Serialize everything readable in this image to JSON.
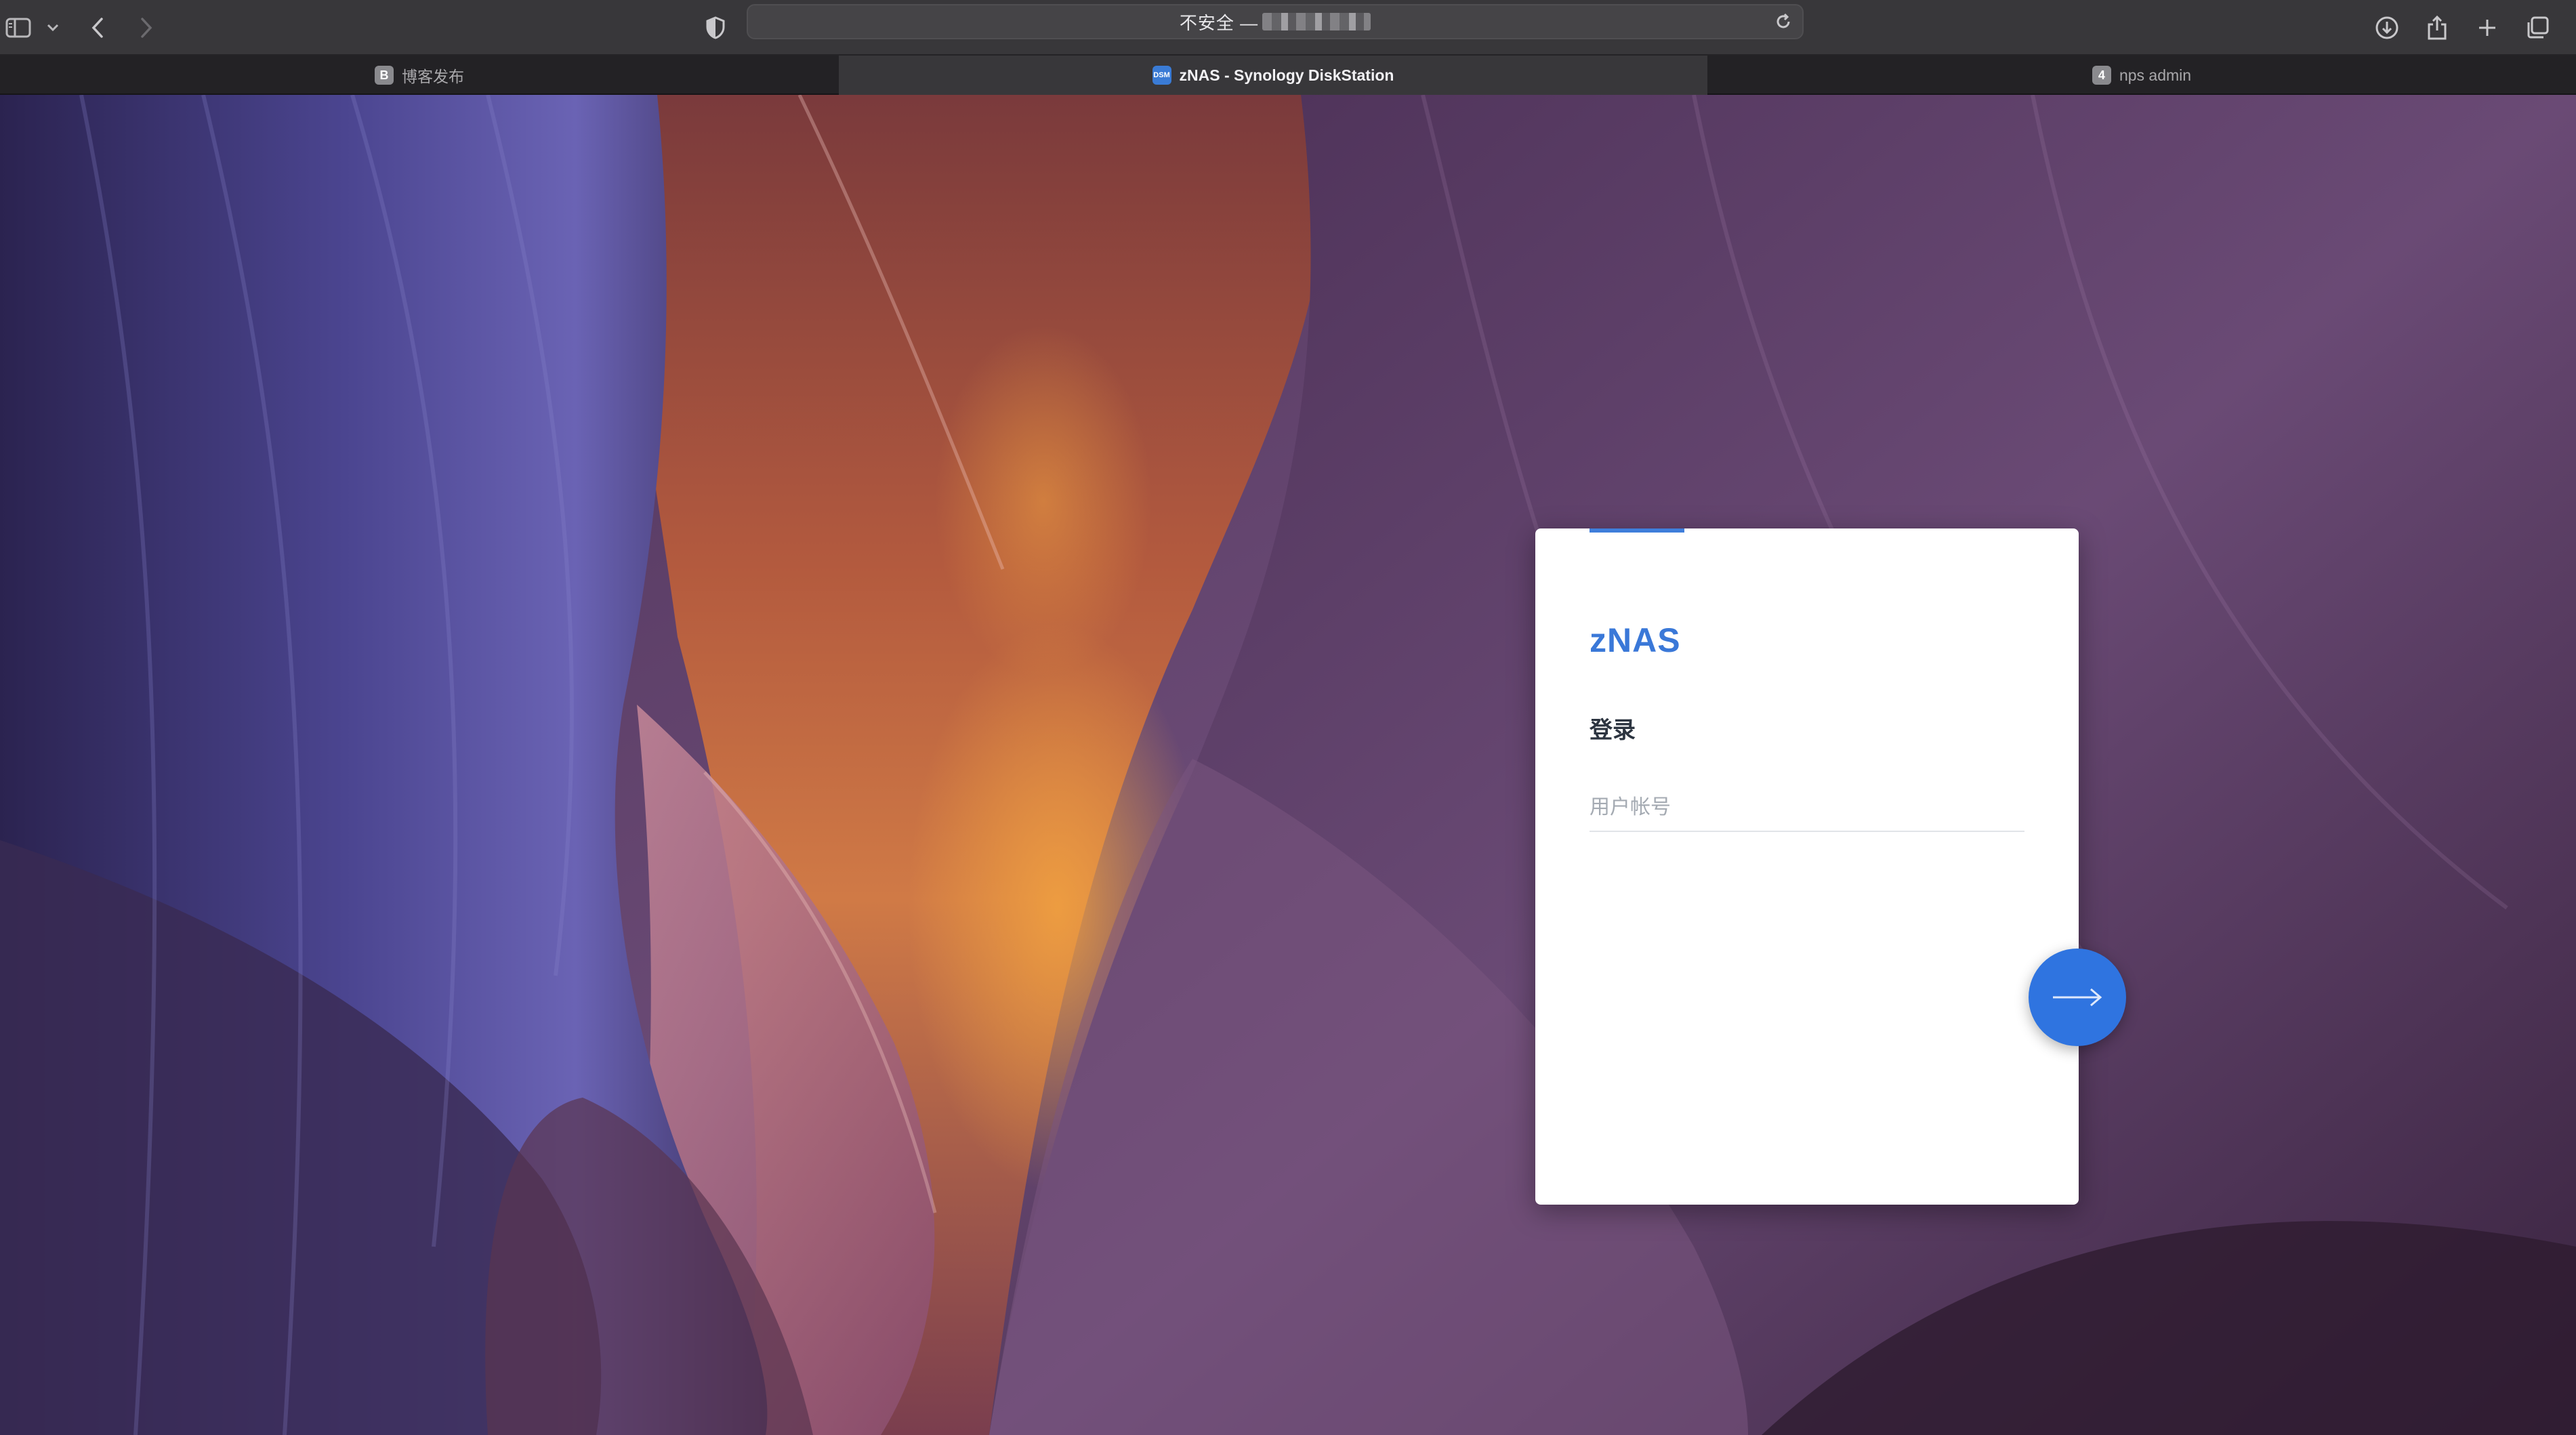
{
  "browser": {
    "address": {
      "security_label": "不安全 —",
      "url_redacted": true
    },
    "icons": {
      "sidebar": "sidebar-icon",
      "sidebar_menu": "chevron-down-icon",
      "back": "chevron-left-icon",
      "forward": "chevron-right-icon",
      "privacy": "shield-icon",
      "reload": "reload-icon",
      "downloads": "download-icon",
      "share": "share-icon",
      "new_tab": "plus-icon",
      "tab_overview": "tabs-icon"
    },
    "tabs": [
      {
        "label": "博客发布",
        "favicon": "B",
        "favicon_color": "#8a8a8e",
        "active": false
      },
      {
        "label": "zNAS - Synology DiskStation",
        "favicon": "DSM",
        "favicon_color": "#3a7bd5",
        "active": true
      },
      {
        "label": "nps admin",
        "favicon": "4",
        "favicon_color": "#8a8a8e",
        "active": false
      }
    ]
  },
  "login": {
    "brand": "zNAS",
    "heading": "登录",
    "username_placeholder": "用户帐号",
    "username_value": "",
    "submit_icon": "arrow-right-icon"
  },
  "colors": {
    "accent": "#3a78d8",
    "submit": "#2f74e0",
    "card_bg": "#ffffff"
  }
}
